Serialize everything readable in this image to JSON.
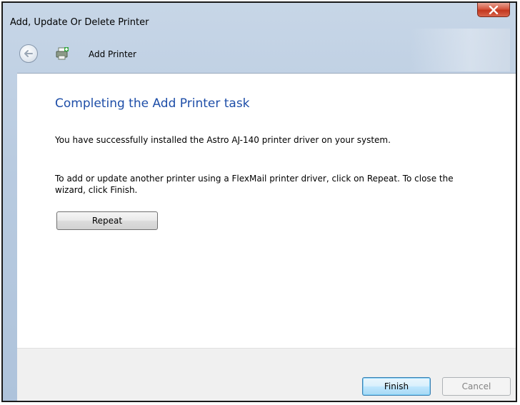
{
  "window": {
    "title": "Add, Update Or Delete Printer",
    "close_icon": "close-icon"
  },
  "nav": {
    "back_icon": "back-arrow-icon",
    "page_icon": "printer-icon",
    "label": "Add Printer"
  },
  "content": {
    "heading": "Completing the Add Printer task",
    "message1": "You have successfully installed the Astro AJ-140 printer driver on your system.",
    "message2": "To add or update another printer using a FlexMail printer driver, click on Repeat. To close the wizard, click Finish.",
    "repeat_label": "Repeat"
  },
  "footer": {
    "finish_label": "Finish",
    "cancel_label": "Cancel",
    "cancel_enabled": false
  },
  "colors": {
    "heading": "#1e4ea8",
    "close_button": "#c2371e",
    "chrome": "#b9cbe0"
  }
}
